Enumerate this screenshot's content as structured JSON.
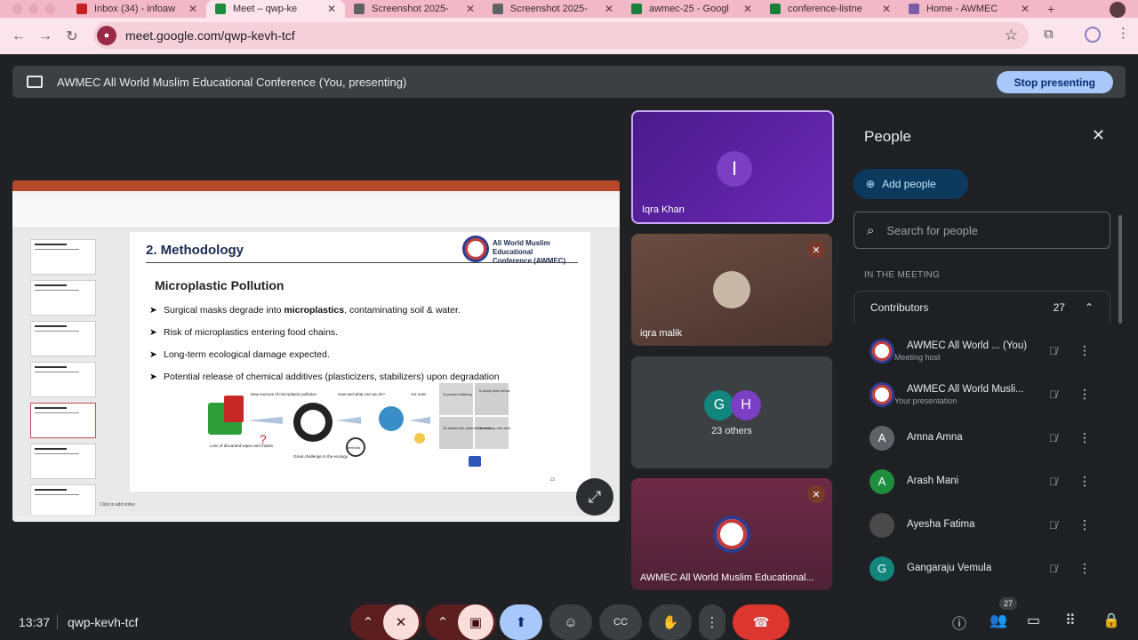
{
  "browser": {
    "tabs": [
      {
        "label": "Inbox (34) - infoaw",
        "color": "#c5221f",
        "active": false
      },
      {
        "label": "Meet – qwp-ke",
        "color": "#1e8e3e",
        "active": true
      },
      {
        "label": "Screenshot 2025-",
        "color": "#5f6368",
        "active": false
      },
      {
        "label": "Screenshot 2025-",
        "color": "#5f6368",
        "active": false
      },
      {
        "label": "awmec-25 - Googl",
        "color": "#188038",
        "active": false
      },
      {
        "label": "conference-listne",
        "color": "#188038",
        "active": false
      },
      {
        "label": "Home - AWMEC",
        "color": "#7b5ea7",
        "active": false
      }
    ],
    "url": "meet.google.com/qwp-kevh-tcf"
  },
  "presenting_bar": {
    "title": "AWMEC All World Muslim Educational Conference (You, presenting)",
    "stop_label": "Stop presenting"
  },
  "slide": {
    "heading": "2. Methodology",
    "org_line1": "All World Muslim Educational",
    "org_line2": "Conference (AWMEC)",
    "subheading": "Microplastic Pollution",
    "bullets": [
      {
        "pre": "Surgical masks degrade into ",
        "bold": "microplastics",
        "post": ", contaminating soil & water."
      },
      {
        "pre": "Risk of microplastics entering food chains.",
        "bold": "",
        "post": ""
      },
      {
        "pre": "Long-term ecological damage expected.",
        "bold": "",
        "post": ""
      },
      {
        "pre": "Potential release of chemical additives (plasticizers, stabilizers) upon degradation",
        "bold": "",
        "post": ""
      }
    ],
    "number": "13",
    "notes_hint": "Click to add notes",
    "diagram_labels": {
      "loss": "Loss of discarded wipes and masks",
      "new_sources": "New sources of microplastic pollution",
      "challenge": "Great challenge to the ecology",
      "how": "How and what can we do?",
      "methods": "Methods",
      "act": "Act now!",
      "prevent": "To prevent littering",
      "study": "To study their behavior and fate",
      "assess": "To assess the potential threats",
      "develop": "To develop new materials"
    }
  },
  "tiles": [
    {
      "name": "Iqra Khan",
      "initial": "I",
      "color": "#7b3fc4"
    },
    {
      "name": "iqra malik"
    },
    {
      "name": "23 others",
      "initials": [
        "G",
        "H"
      ],
      "colors": [
        "#12857c",
        "#7b3fc4"
      ]
    },
    {
      "name": "AWMEC All World Muslim Educational..."
    }
  ],
  "people_panel": {
    "title": "People",
    "add_label": "Add people",
    "search_placeholder": "Search for people",
    "section": "IN THE MEETING",
    "group_label": "Contributors",
    "group_count": "27",
    "participants": [
      {
        "name": "AWMEC All World ... (You)",
        "sub": "Meeting host",
        "initial": "",
        "color": "#ffffff"
      },
      {
        "name": "AWMEC All World Musli...",
        "sub": "Your presentation",
        "initial": "",
        "color": "#ffffff"
      },
      {
        "name": "Amna Amna",
        "sub": "",
        "initial": "A",
        "color": "#5f6368"
      },
      {
        "name": "Arash Mani",
        "sub": "",
        "initial": "A",
        "color": "#1e8e3e"
      },
      {
        "name": "Ayesha Fatima",
        "sub": "",
        "initial": "",
        "color": "#4a4a4a"
      },
      {
        "name": "Gangaraju Vemula",
        "sub": "",
        "initial": "G",
        "color": "#12857c"
      }
    ]
  },
  "bottom": {
    "time": "13:37",
    "code": "qwp-kevh-tcf",
    "people_badge": "27"
  }
}
